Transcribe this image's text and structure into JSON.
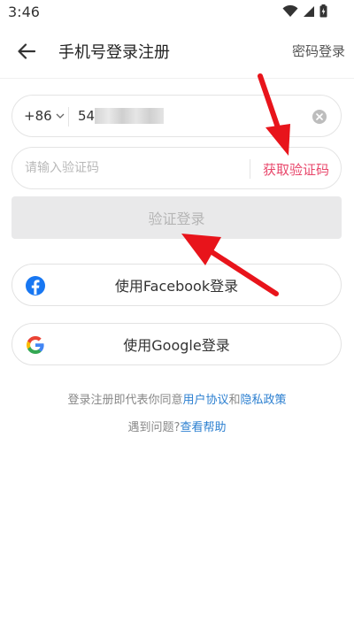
{
  "status_bar": {
    "time": "3:46",
    "icons": [
      "wifi-icon",
      "signal-icon",
      "battery-icon"
    ]
  },
  "app_bar": {
    "title": "手机号登录注册",
    "right_action": "密码登录"
  },
  "phone_field": {
    "country_code": "+86",
    "value_visible": "54",
    "value_obscured": true
  },
  "code_field": {
    "placeholder": "请输入验证码",
    "get_code_label": "获取验证码"
  },
  "login_button": {
    "label": "验证登录"
  },
  "social": {
    "facebook_label": "使用Facebook登录",
    "google_label": "使用Google登录"
  },
  "agreement": {
    "prefix": "登录注册即代表你同意",
    "terms": "用户协议",
    "and": "和",
    "privacy": "隐私政策"
  },
  "help": {
    "question": "遇到问题?",
    "link": "查看帮助"
  },
  "colors": {
    "accent_pink": "#e8476b",
    "link_blue": "#2b7fd0",
    "annotation_red": "#e8141b"
  }
}
